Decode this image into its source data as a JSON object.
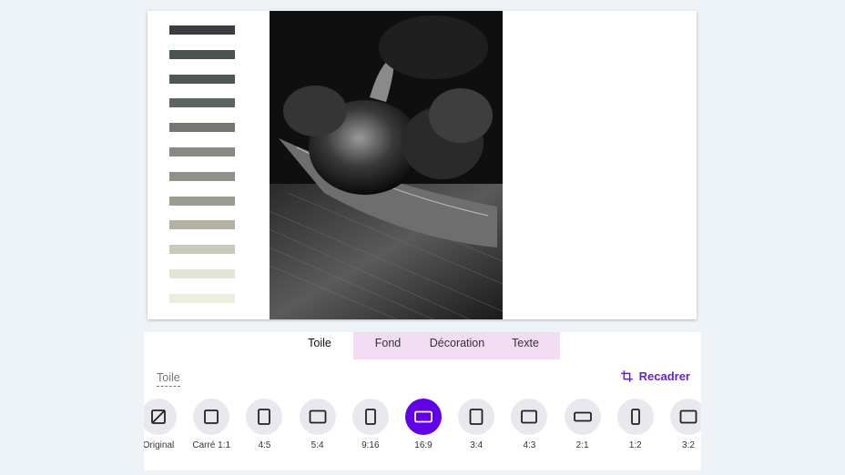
{
  "palette": [
    "#3a3d42",
    "#4a5452",
    "#4f5856",
    "#5c6562",
    "#747771",
    "#878a82",
    "#8e9186",
    "#9b9d91",
    "#b3b2a2",
    "#c9c9bb",
    "#e2e4d6",
    "#eceddd"
  ],
  "tabs": [
    {
      "label": "Toile",
      "active": true
    },
    {
      "label": "Fond",
      "active": false
    },
    {
      "label": "Décoration",
      "active": false
    },
    {
      "label": "Texte",
      "active": false
    }
  ],
  "section": {
    "label": "Toile"
  },
  "crop": {
    "label": "Recadrer",
    "color": "#6a1fd1"
  },
  "ratios": [
    {
      "label": "Original",
      "icon": "original-slash-icon"
    },
    {
      "label": "Carré 1:1",
      "icon": "square-icon"
    },
    {
      "label": "4:5",
      "icon": "portrait-4-5-icon"
    },
    {
      "label": "5:4",
      "icon": "landscape-5-4-icon"
    },
    {
      "label": "9:16",
      "icon": "portrait-9-16-icon"
    },
    {
      "label": "16:9",
      "icon": "landscape-16-9-icon",
      "selected": true
    },
    {
      "label": "3:4",
      "icon": "portrait-3-4-icon"
    },
    {
      "label": "4:3",
      "icon": "landscape-4-3-icon"
    },
    {
      "label": "2:1",
      "icon": "landscape-2-1-icon"
    },
    {
      "label": "1:2",
      "icon": "portrait-1-2-icon"
    },
    {
      "label": "3:2",
      "icon": "landscape-3-2-icon"
    }
  ],
  "accent": "#6200ea"
}
